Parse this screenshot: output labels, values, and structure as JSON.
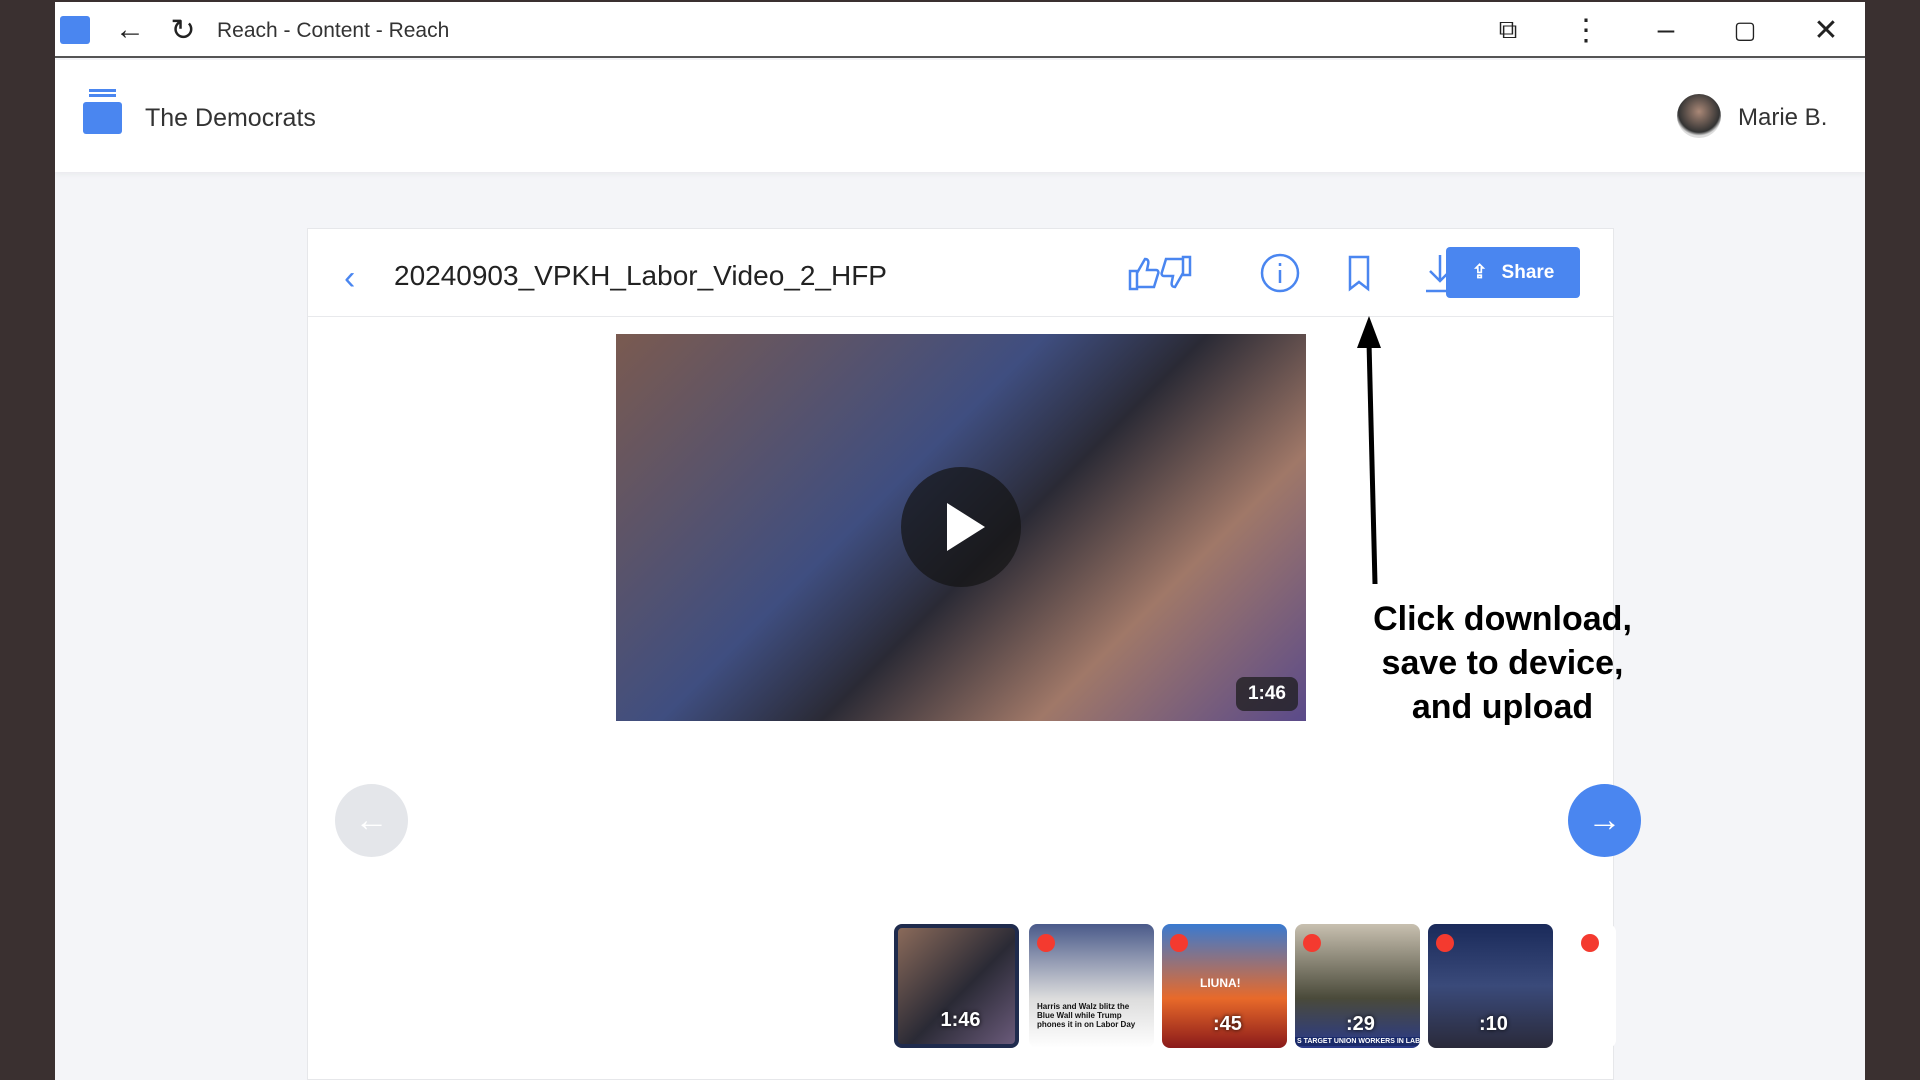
{
  "browser": {
    "title": "Reach - Content - Reach",
    "icons": [
      "app-icon",
      "back-arrow-icon",
      "reload-icon",
      "extensions-icon",
      "more-vert-icon",
      "minimize-icon",
      "maximize-icon",
      "close-icon"
    ]
  },
  "header": {
    "org_name": "The Democrats",
    "user_name": "Marie B."
  },
  "content": {
    "file_title": "20240903_VPKH_Labor_Video_2_HFP",
    "share_label": "Share",
    "accent": "#4a86f0",
    "video": {
      "duration": "1:46"
    },
    "thumbnails": [
      {
        "duration": "1:46",
        "selected": true
      },
      {
        "duration": "",
        "caption": "Harris and Walz blitz the Blue Wall while Trump phones it in on Labor Day"
      },
      {
        "duration": ":45",
        "caption": "LIUNA!"
      },
      {
        "duration": ":29",
        "caption": "S TARGET UNION WORKERS IN LABOR DA"
      },
      {
        "duration": ":10"
      },
      {
        "duration": ""
      }
    ]
  },
  "annotation": {
    "line1": "Click  download,",
    "line2": "save to device,",
    "line3": "and upload"
  }
}
